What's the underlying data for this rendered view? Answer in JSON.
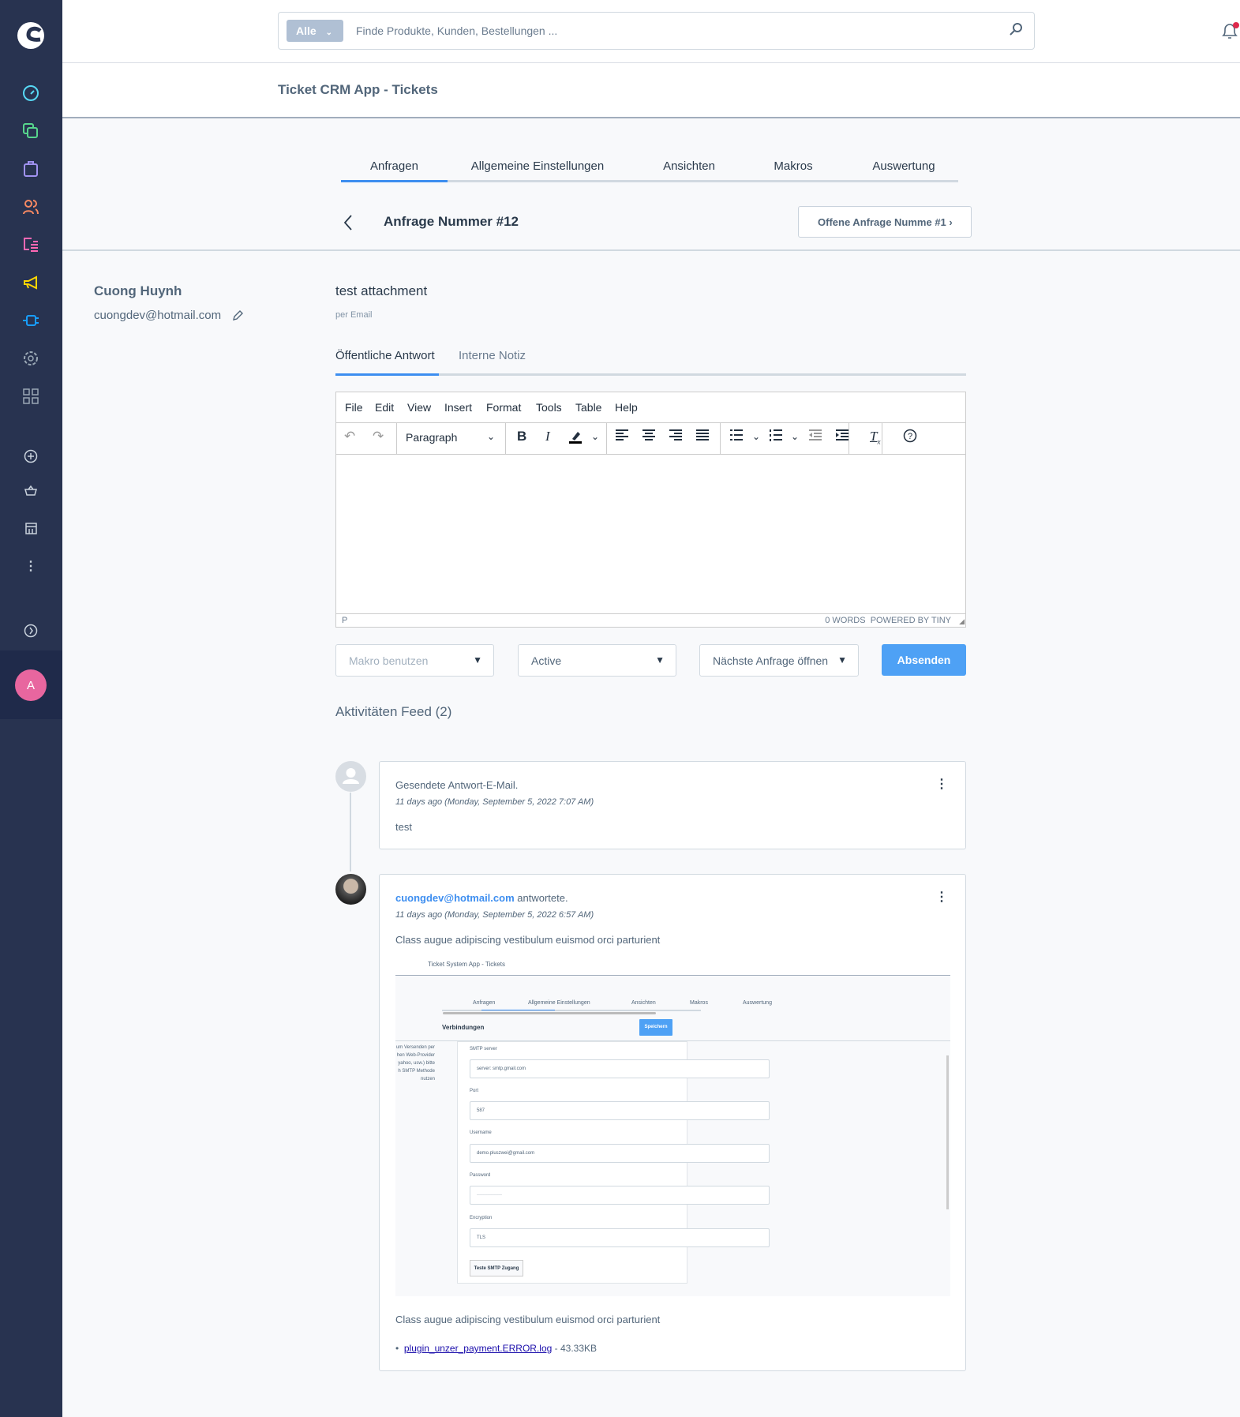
{
  "colors": {
    "sidebar": "#283350",
    "accent": "#3d8ef0",
    "avatar": "#e8669f",
    "notification": "#de294c"
  },
  "sidebar": {
    "icons": [
      "shopware-logo-icon",
      "dashboard-icon",
      "catalogue-icon",
      "orders-icon",
      "customers-icon",
      "content-icon",
      "marketing-icon",
      "extensions-icon",
      "settings-icon",
      "apps-icon",
      "add-icon",
      "sales-channel-basket-icon",
      "storefront-icon",
      "more-icon",
      "expand-icon"
    ],
    "user_initial": "A"
  },
  "search": {
    "scope": "Alle",
    "placeholder": "Finde Produkte, Kunden, Bestellungen ..."
  },
  "header": {
    "title": "Ticket CRM App - Tickets"
  },
  "tabs": [
    {
      "label": "Anfragen",
      "active": true
    },
    {
      "label": "Allgemeine Einstellungen"
    },
    {
      "label": "Ansichten"
    },
    {
      "label": "Makros"
    },
    {
      "label": "Auswertung"
    }
  ],
  "ticket": {
    "title": "Anfrage Nummer #12",
    "next_button": "Offene Anfrage Numme #1",
    "subject": "test attachment",
    "channel": "per Email"
  },
  "customer": {
    "name": "Cuong Huynh",
    "email": "cuongdev@hotmail.com"
  },
  "reply_tabs": [
    {
      "label": "Öffentliche Antwort",
      "active": true
    },
    {
      "label": "Interne Notiz"
    }
  ],
  "editor": {
    "menu": [
      "File",
      "Edit",
      "View",
      "Insert",
      "Format",
      "Tools",
      "Table",
      "Help"
    ],
    "block_format": "Paragraph",
    "path": "P",
    "word_count": "0 WORDS",
    "powered_by": "POWERED BY TINY"
  },
  "actions": {
    "macro_placeholder": "Makro benutzen",
    "status": "Active",
    "next": "Nächste Anfrage öffnen",
    "send": "Absenden"
  },
  "feed": {
    "title": "Aktivitäten Feed (2)",
    "items": [
      {
        "headline": "Gesendete Antwort-E-Mail.",
        "time": "11 days ago (Monday, September 5, 2022 7:07 AM)",
        "body": "test"
      },
      {
        "author": "cuongdev@hotmail.com",
        "action": "antwortete.",
        "time": "11 days ago (Monday, September 5, 2022 6:57 AM)",
        "body": "Class augue adipiscing vestibulum euismod orci parturient",
        "body2": "Class augue adipiscing vestibulum euismod orci parturient",
        "attachment": {
          "name": "plugin_unzer_payment.ERROR.log",
          "size": "- 43.33KB"
        },
        "screenshot": {
          "title": "Ticket System App - Tickets",
          "tabs": [
            "Anfragen",
            "Allgemeine Einstellungen",
            "Ansichten",
            "Makros",
            "Auswertung"
          ],
          "section": "Verbindungen",
          "save": "Speichern",
          "side_text": [
            "um Versenden per",
            "hen Web-Provider",
            "yahoo, usw.) bitte",
            "h SMTP Methode",
            "nutzen"
          ],
          "fields": [
            {
              "label": "SMTP server",
              "value": "server: smtp.gmail.com"
            },
            {
              "label": "Port",
              "value": "587"
            },
            {
              "label": "Username",
              "value": "demo.pluszwei@gmail.com"
            },
            {
              "label": "Password",
              "value": "················"
            },
            {
              "label": "Encryption",
              "value": "TLS"
            }
          ],
          "test_button": "Teste SMTP Zugang"
        }
      }
    ]
  }
}
